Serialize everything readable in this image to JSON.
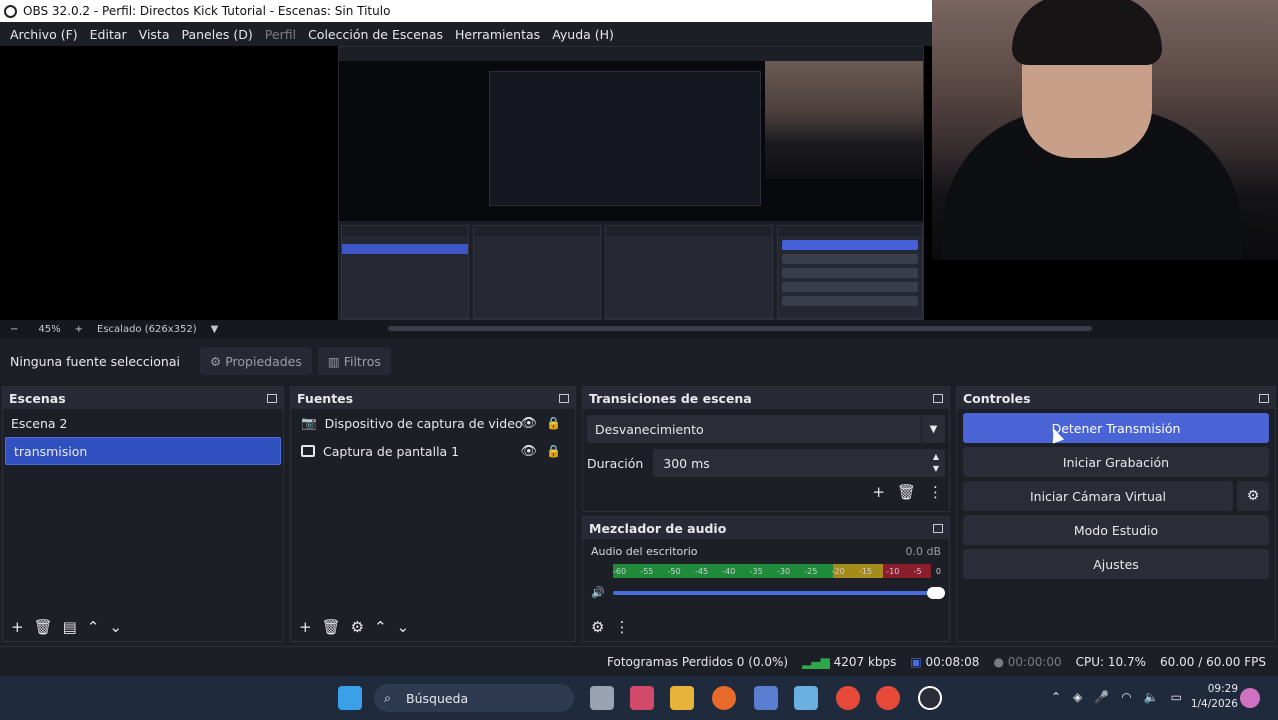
{
  "window": {
    "title": "OBS 32.0.2 - Perfil: Directos Kick Tutorial - Escenas: Sin Titulo"
  },
  "menu": {
    "items": [
      "Archivo (F)",
      "Editar",
      "Vista",
      "Paneles (D)",
      "Perfil",
      "Colección de Escenas",
      "Herramientas",
      "Ayuda (H)"
    ]
  },
  "preview": {
    "zoom_minus": "−",
    "zoom_value": "45%",
    "zoom_plus": "+",
    "scale_label": "Escalado (626x352)"
  },
  "source_toolbar": {
    "no_source": "Ninguna fuente seleccionai",
    "properties": "Propiedades",
    "filters": "Filtros"
  },
  "scenes": {
    "title": "Escenas",
    "items": [
      "Escena 2",
      "transmision"
    ],
    "selected": 1
  },
  "sources": {
    "title": "Fuentes",
    "items": [
      "Dispositivo de captura de video",
      "Captura de pantalla 1"
    ]
  },
  "transitions": {
    "title": "Transiciones de escena",
    "type": "Desvanecimiento",
    "duration_label": "Duración",
    "duration_value": "300 ms"
  },
  "mixer": {
    "title": "Mezclador de audio",
    "track_name": "Audio del escritorio",
    "track_level": "0.0 dB",
    "scale": [
      "-60",
      "-55",
      "-50",
      "-45",
      "-40",
      "-35",
      "-30",
      "-25",
      "-20",
      "-15",
      "-10",
      "-5",
      "0"
    ]
  },
  "controls": {
    "title": "Controles",
    "stop_stream": "Detener Transmisión",
    "start_record": "Iniciar Grabación",
    "virtual_cam": "Iniciar Cámara Virtual",
    "studio_mode": "Modo Estudio",
    "settings": "Ajustes"
  },
  "status": {
    "dropped": "Fotogramas Perdidos 0 (0.0%)",
    "bitrate": "4207 kbps",
    "stream_time": "00:08:08",
    "record_time": "00:00:00",
    "cpu": "CPU: 10.7%",
    "fps": "60.00 / 60.00 FPS"
  },
  "taskbar": {
    "search": "Búsqueda",
    "time": "09:29",
    "date": "1/4/2026"
  },
  "colors": {
    "accent": "#4a64d6",
    "selected": "#3050c0",
    "bg": "#1d1f26"
  }
}
